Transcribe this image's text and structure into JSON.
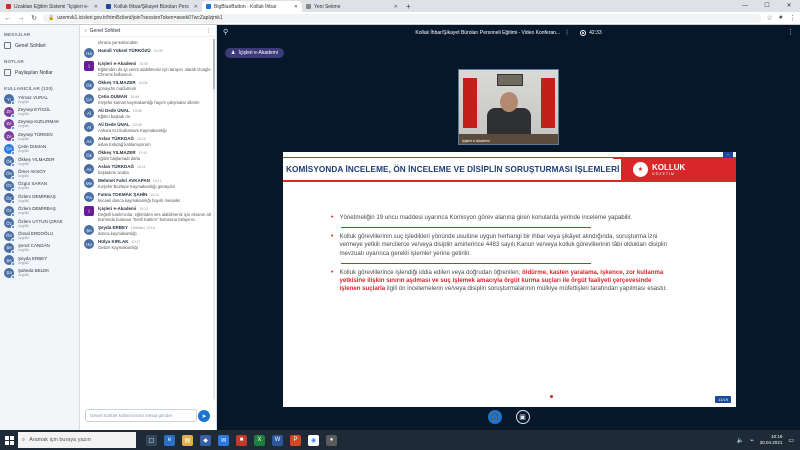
{
  "browser": {
    "tabs": [
      {
        "label": "Uzaktan Eğitim Sistemi \"İçişleri e-",
        "color": "#d9262b",
        "active": false
      },
      {
        "label": "Kolluk İhbar/Şikayet Büroları Pers",
        "color": "#1b4a9a",
        "active": false
      },
      {
        "label": "BigBlueButton - Kolluk İhbar",
        "color": "#1b75d0",
        "active": true
      },
      {
        "label": "Yeni Sekme",
        "color": "#888888",
        "active": false
      }
    ],
    "url": "uzemvk1.icisleri.gov.tr/html5client/join?sessionToken=awek07wcZaplzjmk1"
  },
  "sidebar": {
    "messages_header": "MESAJLAR",
    "public_chat": "Genel Sohbet",
    "notes_header": "NOTLAR",
    "shared_notes": "Paylaşılan Notlar",
    "users_header": "KULLANICILAR (120)",
    "users": [
      {
        "initials": "Yı",
        "name": "Yılmaz VURAL",
        "role": "üzgüllü",
        "color": "#4a6fa5"
      },
      {
        "initials": "Ze",
        "name": "Zeynep EYİGÜL",
        "role": "üzgüllü",
        "color": "#7b3fa0"
      },
      {
        "initials": "Ze",
        "name": "Zeynep KIZILIRMAK",
        "role": "üzgüllü",
        "color": "#7b3fa0"
      },
      {
        "initials": "Ze",
        "name": "Zeynep TÜRKEN",
        "role": "üzgüllü",
        "color": "#7b3fa0"
      },
      {
        "initials": "Çe",
        "name": "Çetin DUMAN",
        "role": "üzgüllü",
        "color": "#2a7ae2"
      },
      {
        "initials": "Ök",
        "name": "Ökkeş YILMAZER",
        "role": "üzgüllü",
        "color": "#4a6fa5"
      },
      {
        "initials": "Ön",
        "name": "Ömer AKSOY",
        "role": "üzgüllü",
        "color": "#4a6fa5"
      },
      {
        "initials": "Öz",
        "name": "Özgür SARAN",
        "role": "üzgüllü",
        "color": "#4a6fa5"
      },
      {
        "initials": "Öz",
        "name": "Özlem DEMİRBAŞ",
        "role": "üzgüllü",
        "color": "#4a6fa5"
      },
      {
        "initials": "Öz",
        "name": "Özlem DEMİRBAŞ",
        "role": "üzgüllü",
        "color": "#4a6fa5"
      },
      {
        "initials": "Öz",
        "name": "Özlem UYTUN ÇIRAK",
        "role": "üzgüllü",
        "color": "#4a6fa5"
      },
      {
        "initials": "Ön",
        "name": "Önsal ERDOĞLU",
        "role": "üzgüllü",
        "color": "#4a6fa5"
      },
      {
        "initials": "Şe",
        "name": "Şenol CANDAN",
        "role": "üzgüllü",
        "color": "#4a6fa5"
      },
      {
        "initials": "Şe",
        "name": "Şeyda ERBEY",
        "role": "üzgüllü",
        "color": "#4a6fa5"
      },
      {
        "initials": "Şa",
        "name": "Şaheda BELEK",
        "role": "üzgüllü",
        "color": "#4a6fa5"
      }
    ]
  },
  "chat": {
    "title": "Genel Sohbet",
    "input_placeholder": "Genel Sohbet kullanıcısına mesaj gönder",
    "messages": [
      {
        "initials": "",
        "name": "",
        "time": "",
        "text": "ekrana yansıtılacaktır.",
        "color": "#ffffff",
        "sq": false
      },
      {
        "initials": "Ha",
        "name": "Hamdi Yüksel TÜRKÖZÜ",
        "time": "10:05",
        "text": "",
        "color": "#4a6fa5",
        "sq": false
      },
      {
        "initials": "İ",
        "name": "İçişleri e-Akademi",
        "time": "10:05",
        "text": "Eğitimden da iyi verim alabilmeniz için tarayıcı olarak Google Chrome kullanınız.",
        "color": "#6a1b9a",
        "sq": true
      },
      {
        "initials": "Ök",
        "name": "Ökkeş YILMAZER",
        "time": "10:06",
        "text": "günaydın madumum",
        "color": "#4a6fa5",
        "sq": false
      },
      {
        "initials": "Çe",
        "name": "Çetin DUMAN",
        "time": "10:06",
        "text": "Kırşehir kaman kaymakamlığı hayırlı çalışmalar dilerim",
        "color": "#4a6fa5",
        "sq": false
      },
      {
        "initials": "Al",
        "name": "Ali Dede ÜNAL",
        "time": "10:08",
        "text": "Eğitim başladı mı",
        "color": "#4a6fa5",
        "sq": false
      },
      {
        "initials": "Al",
        "name": "Ali Dede ÜNAL",
        "time": "10:08",
        "text": "Ankara Kızılcahamam Kaymakamlığı",
        "color": "#4a6fa5",
        "sq": false
      },
      {
        "initials": "As",
        "name": "Aslan TÜRKDAĞ",
        "time": "10:10",
        "text": "aslan türkdağ katılamıyorum",
        "color": "#4a6fa5",
        "sq": false
      },
      {
        "initials": "Ök",
        "name": "Ökkeş YILMAZER",
        "time": "10:11",
        "text": "eğitim başlamadı daha",
        "color": "#4a6fa5",
        "sq": false
      },
      {
        "initials": "As",
        "name": "Aslan TÜRKDAĞ",
        "time": "10:11",
        "text": "başladımı acaba",
        "color": "#4a6fa5",
        "sq": false
      },
      {
        "initials": "Me",
        "name": "Mehmet Fahri AVKAPAN",
        "time": "10:11",
        "text": "Kırşehir Boztepe Kaymakamlığı günaydın",
        "color": "#4a6fa5",
        "sq": false
      },
      {
        "initials": "Fa",
        "name": "Fatma TOKMAK ŞAHİN",
        "time": "10:11",
        "text": "kocaeli darıca kaymakamlığı hayırlı mesailer",
        "color": "#4a6fa5",
        "sq": false
      },
      {
        "initials": "İ",
        "name": "İçişleri e-Akademi",
        "time": "10:12",
        "text": "Değerli katılımcılar, eğitimden ses alabilmeniz için ekranın alt kısmında bulunan \"Sesli Katılım\" butonuna tıklayınız.",
        "color": "#6a1b9a",
        "sq": true
      },
      {
        "initials": "Şe",
        "name": "Şeyda ERBEY",
        "time": "(Yetkisiz)  10:16",
        "text": "darıca kaymakamlığı",
        "color": "#4a6fa5",
        "sq": false
      },
      {
        "initials": "Hü",
        "name": "Hülya KIRLAK",
        "time": "10:17",
        "text": "Gebze Kaymakamlığı",
        "color": "#4a6fa5",
        "sq": false
      }
    ]
  },
  "main": {
    "meeting_title": "Kolluk İhbar/Şikayet Büroları Personeli Eğitimi - Video Konferan...",
    "timer": "42:33",
    "presenter_label": "İçişleri e-Akademi",
    "webcam_name": "İçişleri e-Akademi",
    "slide": {
      "title": "KOMİSYONDA İNCELEME, ÖN İNCELEME VE DİSİPLİN SORUŞTURMASI İŞLEMLERİ",
      "logo_text": "KOLLUK",
      "logo_sub": "GÖZETİM",
      "page": "11/19",
      "bullet1": "Yönetmeliğin 19 uncu maddesi uyarınca Komisyon görev alanına giren konularda yerinde inceleme yapabilir.",
      "bullet2": "Kolluk görevlilerinin suç işledikleri yönünde usulüne uygun herhangi bir ihbar veya şikâyet alındığında, soruşturma izni vermeye yetkili mercilerce ve/veya disiplin amirlerince 4483 sayılı Kanun ve/veya kolluk görevlilerinin tâbi oldukları disiplin mevzuatı uyarınca gerekli işlemler yerine getirilir.",
      "bullet3_a": "Kolluk görevlilerince işlendiği iddia edilen veya doğrudan öğrenilen; ",
      "bullet3_red": "öldürme, kasten yaralama, işkence, zor kullanma yetkisine ilişkin sınırın aşılması ve suç işlemek amacıyla örgüt kurma suçları ile örgüt faaliyeti çerçevesinde işlenen suçlarla",
      "bullet3_b": " ilgili ön incelemelerin ve/veya disiplin soruşturmalarının mülkiye müfettişleri tarafından yapılması esastır."
    }
  },
  "taskbar": {
    "search_placeholder": "Aramak için buraya yazın",
    "time": "10:19",
    "date": "30.04.2021"
  }
}
